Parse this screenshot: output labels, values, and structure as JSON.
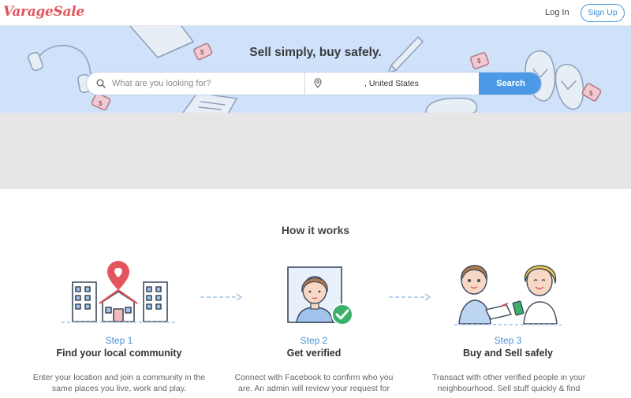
{
  "header": {
    "logo": "VarageSale",
    "login_label": "Log In",
    "signup_label": "Sign Up"
  },
  "hero": {
    "title": "Sell simply, buy safely.",
    "search_placeholder": "What are you looking for?",
    "location_value": ", United States",
    "search_button": "Search",
    "price_tag_symbol": "$"
  },
  "how_it_works": {
    "title": "How it works",
    "steps": [
      {
        "number": "Step 1",
        "title": "Find your local community",
        "description": "Enter your location and join a community in the same places you live, work and play.",
        "icon": "community-map-icon"
      },
      {
        "number": "Step 2",
        "title": "Get verified",
        "description": "Connect with Facebook to confirm who you are. An admin will review your request for",
        "icon": "verified-profile-icon"
      },
      {
        "number": "Step 3",
        "title": "Buy and Sell safely",
        "description": "Transact with other verified people in your neighbourhood. Sell stuff quickly & find",
        "icon": "exchange-icon"
      }
    ]
  },
  "colors": {
    "brand": "#e3545c",
    "accent": "#4c9ae5",
    "hero_bg": "#cfe2fa",
    "band_bg": "#e6e6e6"
  }
}
